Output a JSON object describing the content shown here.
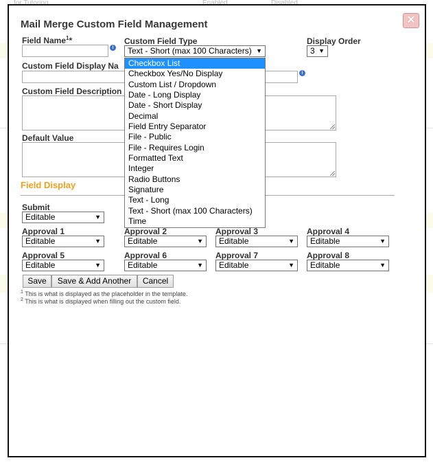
{
  "background": {
    "top_texts": [
      "for Tutoring",
      "Enabled",
      "Disabled"
    ]
  },
  "modal": {
    "title": "Mail Merge Custom Field Management",
    "close_icon": "close-icon",
    "field_name": {
      "label": "Field Name",
      "sup": "1",
      "required": "*",
      "value": ""
    },
    "custom_field_type": {
      "label": "Custom Field Type",
      "selected": "Text - Short (max 100 Characters)"
    },
    "display_order": {
      "label": "Display Order",
      "selected": "3"
    },
    "display_name": {
      "label": "Custom Field Display Na",
      "value": ""
    },
    "description": {
      "label": "Custom Field Description",
      "value": ""
    },
    "default_value": {
      "label": "Default Value",
      "value": ""
    },
    "field_display": {
      "title": "Field Display",
      "submit": {
        "label": "Submit",
        "value": "Editable"
      },
      "approvals": [
        {
          "label": "Approval 1",
          "value": "Editable"
        },
        {
          "label": "Approval 2",
          "value": "Editable"
        },
        {
          "label": "Approval 3",
          "value": "Editable"
        },
        {
          "label": "Approval 4",
          "value": "Editable"
        },
        {
          "label": "Approval 5",
          "value": "Editable"
        },
        {
          "label": "Approval 6",
          "value": "Editable"
        },
        {
          "label": "Approval 7",
          "value": "Editable"
        },
        {
          "label": "Approval 8",
          "value": "Editable"
        }
      ]
    },
    "buttons": {
      "save": "Save",
      "save_add": "Save & Add Another",
      "cancel": "Cancel"
    },
    "footnotes": [
      {
        "num": "1",
        "text": "This is what is displayed as the placeholder in the template."
      },
      {
        "num": "2",
        "text": "This is what is displayed when filling out the custom field."
      }
    ],
    "type_options": [
      "Checkbox List",
      "Checkbox Yes/No Display",
      "Custom List / Dropdown",
      "Date - Long Display",
      "Date - Short Display",
      "Decimal",
      "Field Entry Separator",
      "File - Public",
      "File - Requires Login",
      "Formatted Text",
      "Integer",
      "Radio Buttons",
      "Signature",
      "Text - Long",
      "Text - Short (max 100 Characters)",
      "Time"
    ],
    "highlighted_option": "Checkbox List"
  },
  "colors": {
    "accent": "#f0a020",
    "highlight": "#1e90ff",
    "close": "#f2c4c4"
  }
}
